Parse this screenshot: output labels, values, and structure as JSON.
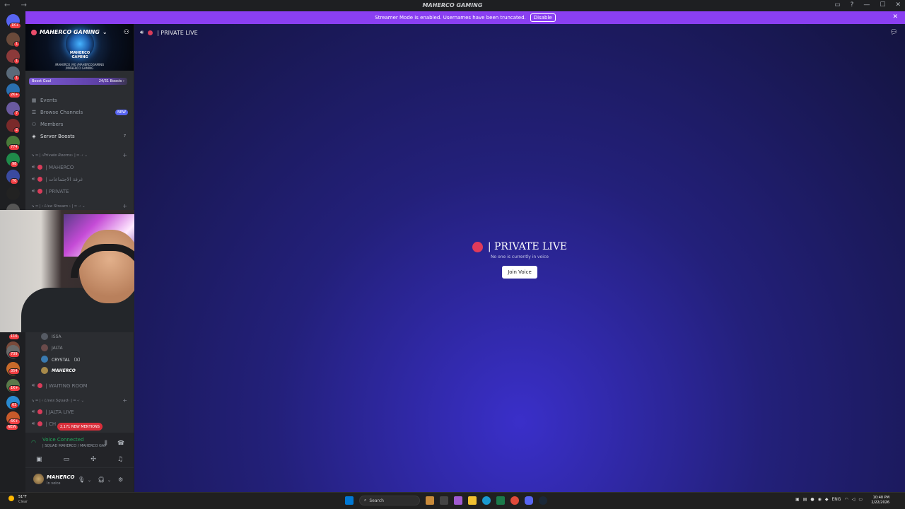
{
  "window": {
    "title": "MAHERCO GAMING",
    "nav_arrows": "← →",
    "controls": [
      "▭",
      "?",
      "—",
      "☐",
      "✕"
    ]
  },
  "banner": {
    "message": "Streamer Mode is enabled. Usernames have been truncated.",
    "button": "Disable",
    "close": "✕"
  },
  "rail": {
    "badges": [
      "1K+",
      "1",
      "1",
      "2K+",
      "7",
      "2",
      "774",
      "98",
      "70",
      "NEW",
      "116",
      "739",
      "354",
      "1K+",
      "63",
      "6K+"
    ]
  },
  "server": {
    "name": "MAHERCO GAMING",
    "logo_text": "MAHERCO GAMING",
    "socials_line1": "/MAHERCO_MG   /MAHERCOGAMING",
    "socials_line2": "/MAHERCO GAMING",
    "boost_label": "Boost Goal",
    "boost_count": "24/31 Boosts ›"
  },
  "nav": {
    "events": "Events",
    "browse": "Browse Channels",
    "browse_badge": "NEW",
    "members": "Members",
    "boosts": "Server Boosts",
    "boosts_count": "7"
  },
  "categories": {
    "private_rooms": "↘ ━ | ‹Private Rooms› | ━ ·‹ ⌄",
    "live_stream": "↘ ━ | ‹ Live Stream › | ━ ·‹ ⌄",
    "lives_squad": "↘ ━ | ‹ Lives Squad› | ━ ·‹ ⌄"
  },
  "channels": {
    "maherco": "| MAHERCO",
    "arabic": "| غرفة الاجتماعات",
    "private": "| PRIVATE",
    "waiting": "| WAITING ROOM",
    "jalta_live": "| JALTA LIVE",
    "partial": "| CH"
  },
  "members": {
    "issa": "ISSA",
    "jalta": "JALTA",
    "crystal": "CRYSTAL 〔X〕",
    "maherco": "MAHERCO"
  },
  "mentions": "2,171 NEW MENTIONS",
  "voice": {
    "title": "Voice Connected",
    "channel": "| SQUAD MAHERCO / MAHERCO GAM..."
  },
  "user": {
    "name": "MAHERCO",
    "status": "In voice"
  },
  "main": {
    "header": "| PRIVATE LIVE",
    "title": "| PRIVATE LIVE",
    "subtitle": "No one is currently in voice",
    "join_button": "Join Voice"
  },
  "taskbar": {
    "temp": "51°F",
    "weather": "Clear",
    "search_placeholder": "Search",
    "lang": "ENG",
    "time": "10:40 PM",
    "date": "2/22/2026"
  },
  "colors": {
    "accent": "#8a3ff2",
    "channel_dot": "#d93c5a",
    "voice_green": "#23a55a"
  }
}
